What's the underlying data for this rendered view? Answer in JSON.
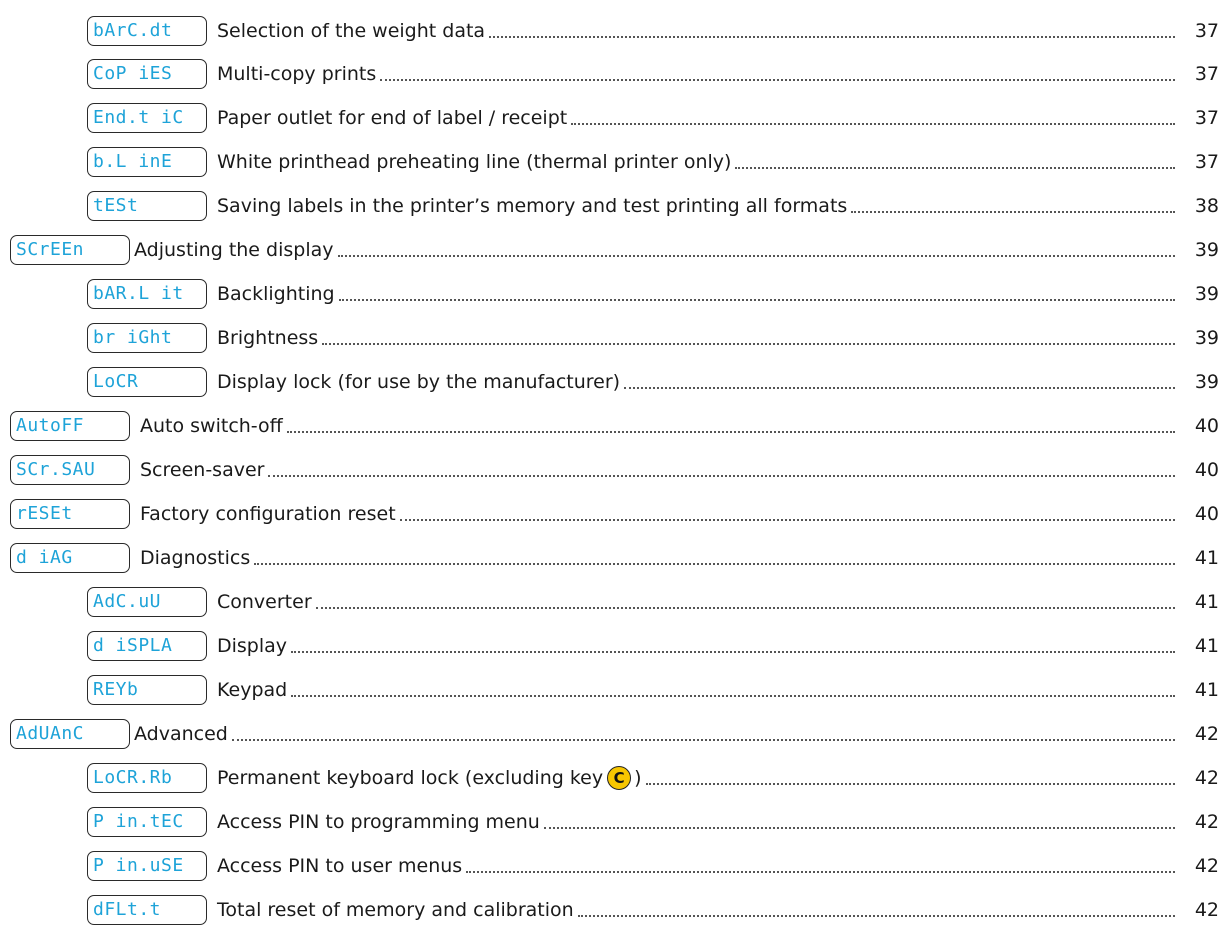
{
  "entries": [
    {
      "code": "bArC.dt",
      "text": "Selection of the weight data",
      "page": "37"
    },
    {
      "code": "CoP iES",
      "text": "Multi-copy prints",
      "page": "37"
    },
    {
      "code": "End.t iC",
      "text": "Paper outlet for end of label / receipt",
      "page": "37"
    },
    {
      "code": "b.L inE",
      "text": "White printhead preheating line (thermal printer only)",
      "page": "37"
    },
    {
      "code": "tESt",
      "text": "Saving labels in the printer’s memory and test printing all formats",
      "page": "38"
    },
    {
      "code": "SCrEEn",
      "text": "Adjusting the display",
      "page": "39"
    },
    {
      "code": "bAR.L it",
      "text": "Backlighting",
      "page": "39"
    },
    {
      "code": "br iGht",
      "text": "Brightness",
      "page": "39"
    },
    {
      "code": "LoCR",
      "text": "Display lock (for use by the manufacturer)",
      "page": "39"
    },
    {
      "code": "AutoFF",
      "text": "Auto switch-off",
      "page": "40"
    },
    {
      "code": "SCr.SAU",
      "text": "Screen-saver",
      "page": "40"
    },
    {
      "code": "rESEt",
      "text": "Factory configuration reset",
      "page": "40"
    },
    {
      "code": "d iAG",
      "text": "Diagnostics",
      "page": "41"
    },
    {
      "code": "AdC.uU",
      "text": "Converter",
      "page": "41"
    },
    {
      "code": "d iSPLA",
      "text": "Display",
      "page": "41"
    },
    {
      "code": "REYb",
      "text": "Keypad",
      "page": "41"
    },
    {
      "code": "AdUAnC",
      "text": "Advanced",
      "page": "42"
    },
    {
      "code": "LoCR.Rb",
      "text": "Permanent keyboard lock (excluding key",
      "key": "C",
      "text_after": ")",
      "page": "42"
    },
    {
      "code": "P in.tEC",
      "text": "Access PIN to programming menu",
      "page": "42"
    },
    {
      "code": "P in.uSE",
      "text": "Access PIN to user menus",
      "page": "42"
    },
    {
      "code": "dFLt.t",
      "text": "Total reset of memory and calibration",
      "page": "42"
    }
  ]
}
